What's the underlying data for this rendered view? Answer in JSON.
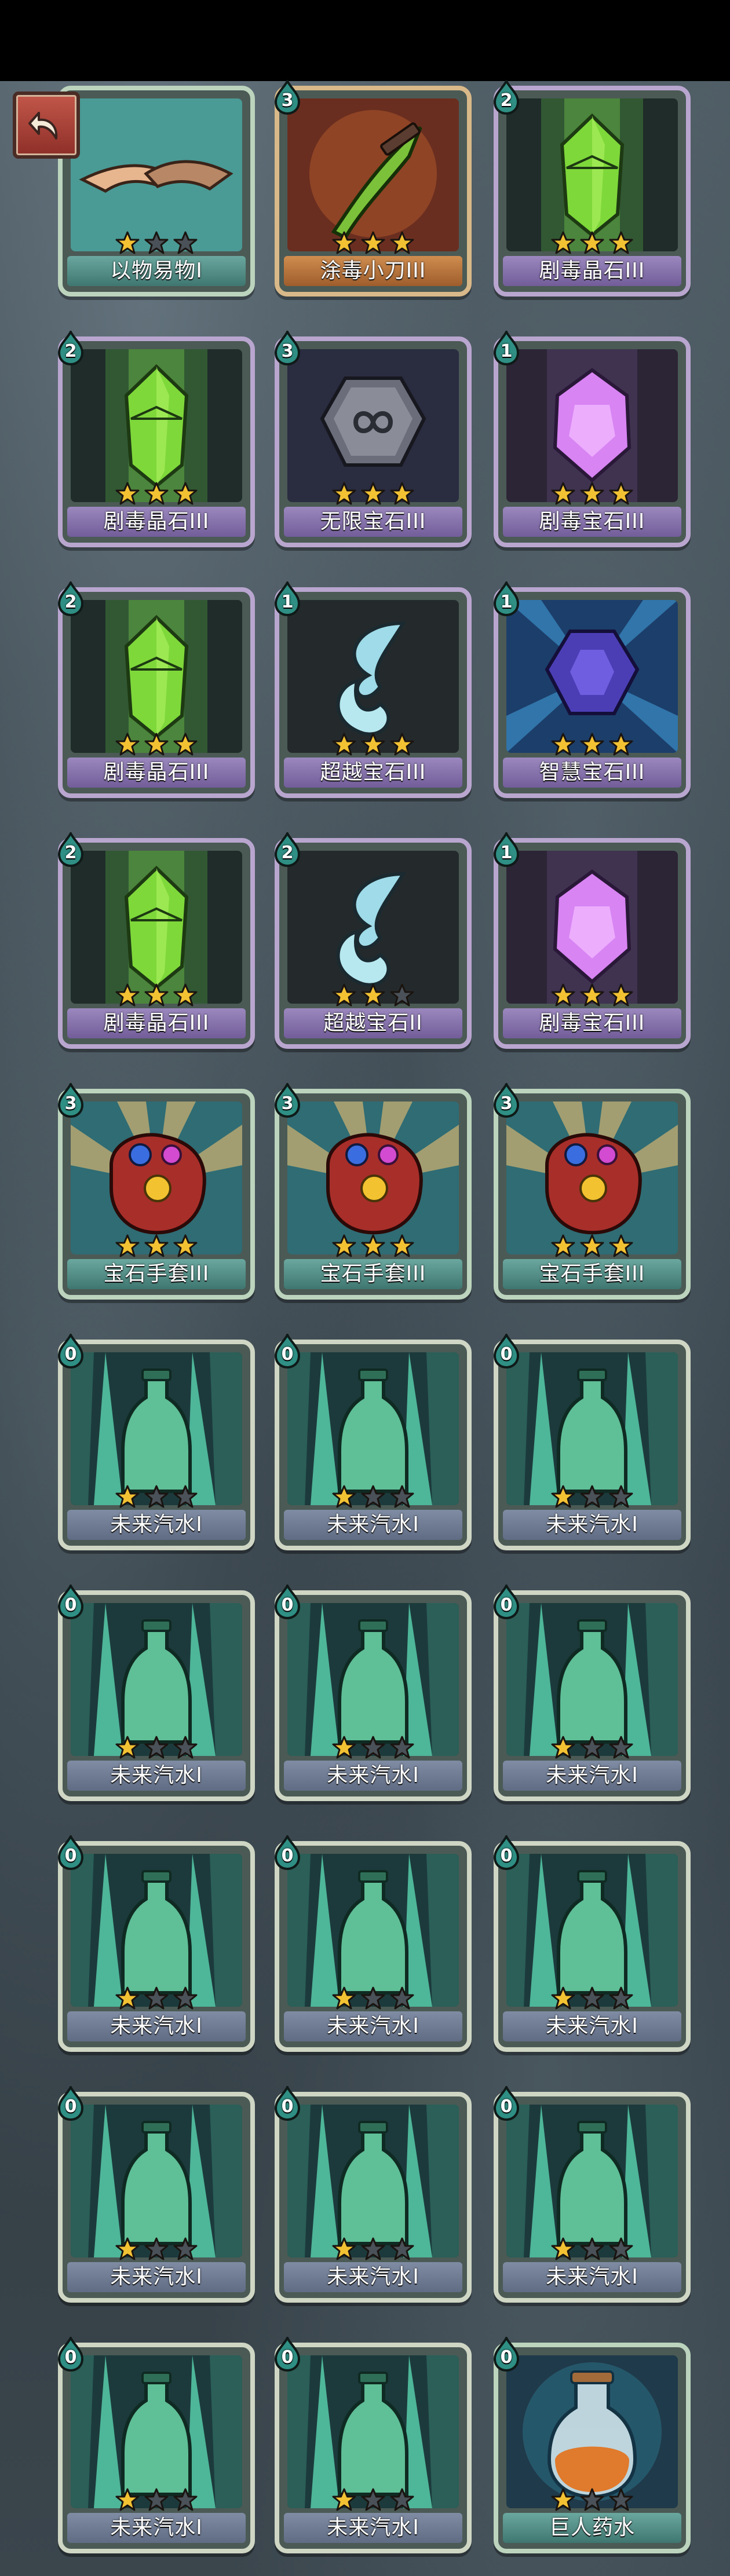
{
  "colors": {
    "star_on": "#f3c233",
    "star_off": "#4a5158",
    "badge": "#2f8f84"
  },
  "back_button": {
    "icon": "back-arrow-icon"
  },
  "cards": [
    {
      "name": "以物易物I",
      "cost": "",
      "stars": 1,
      "rarity": "teal",
      "icon": "handshake-icon"
    },
    {
      "name": "涂毒小刀III",
      "cost": "3",
      "stars": 3,
      "rarity": "orange",
      "icon": "poison-dagger-icon"
    },
    {
      "name": "剧毒晶石III",
      "cost": "2",
      "stars": 3,
      "rarity": "purple",
      "icon": "green-crystal-icon"
    },
    {
      "name": "剧毒晶石III",
      "cost": "2",
      "stars": 3,
      "rarity": "purple",
      "icon": "green-crystal-icon"
    },
    {
      "name": "无限宝石III",
      "cost": "3",
      "stars": 3,
      "rarity": "purple",
      "icon": "infinity-gem-icon"
    },
    {
      "name": "剧毒宝石III",
      "cost": "1",
      "stars": 3,
      "rarity": "purple",
      "icon": "purple-gem-icon"
    },
    {
      "name": "剧毒晶石III",
      "cost": "2",
      "stars": 3,
      "rarity": "purple",
      "icon": "green-crystal-icon"
    },
    {
      "name": "超越宝石III",
      "cost": "1",
      "stars": 3,
      "rarity": "purple",
      "icon": "swirl-gem-icon"
    },
    {
      "name": "智慧宝石III",
      "cost": "1",
      "stars": 3,
      "rarity": "purple",
      "icon": "wisdom-gem-icon"
    },
    {
      "name": "剧毒晶石III",
      "cost": "2",
      "stars": 3,
      "rarity": "purple",
      "icon": "green-crystal-icon"
    },
    {
      "name": "超越宝石II",
      "cost": "2",
      "stars": 2,
      "rarity": "purple",
      "icon": "swirl-gem-icon"
    },
    {
      "name": "剧毒宝石III",
      "cost": "1",
      "stars": 3,
      "rarity": "purple",
      "icon": "purple-gem-icon"
    },
    {
      "name": "宝石手套III",
      "cost": "3",
      "stars": 3,
      "rarity": "teal",
      "icon": "gem-gauntlet-icon"
    },
    {
      "name": "宝石手套III",
      "cost": "3",
      "stars": 3,
      "rarity": "teal",
      "icon": "gem-gauntlet-icon"
    },
    {
      "name": "宝石手套III",
      "cost": "3",
      "stars": 3,
      "rarity": "teal",
      "icon": "gem-gauntlet-icon"
    },
    {
      "name": "未来汽水I",
      "cost": "0",
      "stars": 1,
      "rarity": "green",
      "icon": "soda-bottle-icon"
    },
    {
      "name": "未来汽水I",
      "cost": "0",
      "stars": 1,
      "rarity": "green",
      "icon": "soda-bottle-icon"
    },
    {
      "name": "未来汽水I",
      "cost": "0",
      "stars": 1,
      "rarity": "green",
      "icon": "soda-bottle-icon"
    },
    {
      "name": "未来汽水I",
      "cost": "0",
      "stars": 1,
      "rarity": "green",
      "icon": "soda-bottle-icon"
    },
    {
      "name": "未来汽水I",
      "cost": "0",
      "stars": 1,
      "rarity": "green",
      "icon": "soda-bottle-icon"
    },
    {
      "name": "未来汽水I",
      "cost": "0",
      "stars": 1,
      "rarity": "green",
      "icon": "soda-bottle-icon"
    },
    {
      "name": "未来汽水I",
      "cost": "0",
      "stars": 1,
      "rarity": "green",
      "icon": "soda-bottle-icon"
    },
    {
      "name": "未来汽水I",
      "cost": "0",
      "stars": 1,
      "rarity": "green",
      "icon": "soda-bottle-icon"
    },
    {
      "name": "未来汽水I",
      "cost": "0",
      "stars": 1,
      "rarity": "green",
      "icon": "soda-bottle-icon"
    },
    {
      "name": "未来汽水I",
      "cost": "0",
      "stars": 1,
      "rarity": "green",
      "icon": "soda-bottle-icon"
    },
    {
      "name": "未来汽水I",
      "cost": "0",
      "stars": 1,
      "rarity": "green",
      "icon": "soda-bottle-icon"
    },
    {
      "name": "未来汽水I",
      "cost": "0",
      "stars": 1,
      "rarity": "green",
      "icon": "soda-bottle-icon"
    },
    {
      "name": "未来汽水I",
      "cost": "0",
      "stars": 1,
      "rarity": "green",
      "icon": "soda-bottle-icon"
    },
    {
      "name": "未来汽水I",
      "cost": "0",
      "stars": 1,
      "rarity": "green",
      "icon": "soda-bottle-icon"
    },
    {
      "name": "巨人药水",
      "cost": "0",
      "stars": 1,
      "rarity": "teal",
      "icon": "giant-potion-icon"
    }
  ]
}
